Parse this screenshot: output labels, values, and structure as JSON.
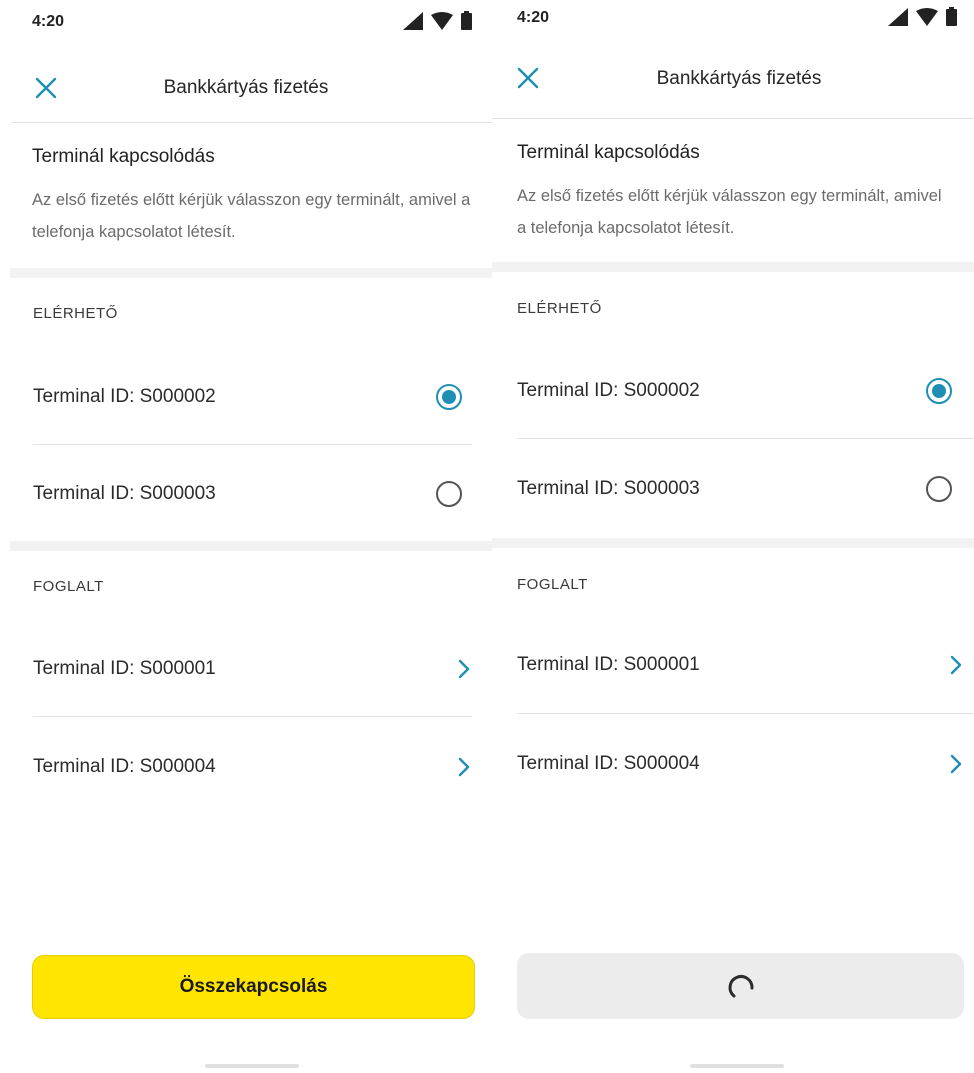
{
  "colors": {
    "accent": "#1e8fb3",
    "primary_button": "#ffe500",
    "disabled_button": "#ececec",
    "separator_band": "#f2f2f2"
  },
  "screens": [
    {
      "state": "ready",
      "status_bar": {
        "time": "4:20",
        "icons": [
          "signal-icon",
          "wifi-icon",
          "battery-icon"
        ]
      },
      "app_bar": {
        "title": "Bankkártyás fizetés",
        "close_icon": "close-icon"
      },
      "intro": {
        "title": "Terminál kapcsolódás",
        "text": "Az első fizetés előtt kérjük válasszon egy terminált, amivel a telefonja kapcsolatot létesít."
      },
      "available": {
        "label": "ELÉRHETŐ",
        "items": [
          {
            "label": "Terminal ID: S000002",
            "selected": true
          },
          {
            "label": "Terminal ID: S000003",
            "selected": false
          }
        ]
      },
      "busy": {
        "label": "FOGLALT",
        "items": [
          {
            "label": "Terminal ID: S000001",
            "icon": "chevron-right-icon"
          },
          {
            "label": "Terminal ID: S000004",
            "icon": "chevron-right-icon"
          }
        ]
      },
      "button": {
        "label": "Összekapcsolás"
      }
    },
    {
      "state": "loading",
      "status_bar": {
        "time": "4:20",
        "icons": [
          "signal-icon",
          "wifi-icon",
          "battery-icon"
        ]
      },
      "app_bar": {
        "title": "Bankkártyás fizetés",
        "close_icon": "close-icon"
      },
      "intro": {
        "title": "Terminál kapcsolódás",
        "text": "Az első fizetés előtt kérjük válasszon egy terminált, amivel a telefonja kapcsolatot létesít."
      },
      "available": {
        "label": "ELÉRHETŐ",
        "items": [
          {
            "label": "Terminal ID: S000002",
            "selected": true
          },
          {
            "label": "Terminal ID: S000003",
            "selected": false
          }
        ]
      },
      "busy": {
        "label": "FOGLALT",
        "items": [
          {
            "label": "Terminal ID: S000001",
            "icon": "chevron-right-icon"
          },
          {
            "label": "Terminal ID: S000004",
            "icon": "chevron-right-icon"
          }
        ]
      },
      "button": {
        "icon": "loading-spinner-icon"
      }
    }
  ]
}
